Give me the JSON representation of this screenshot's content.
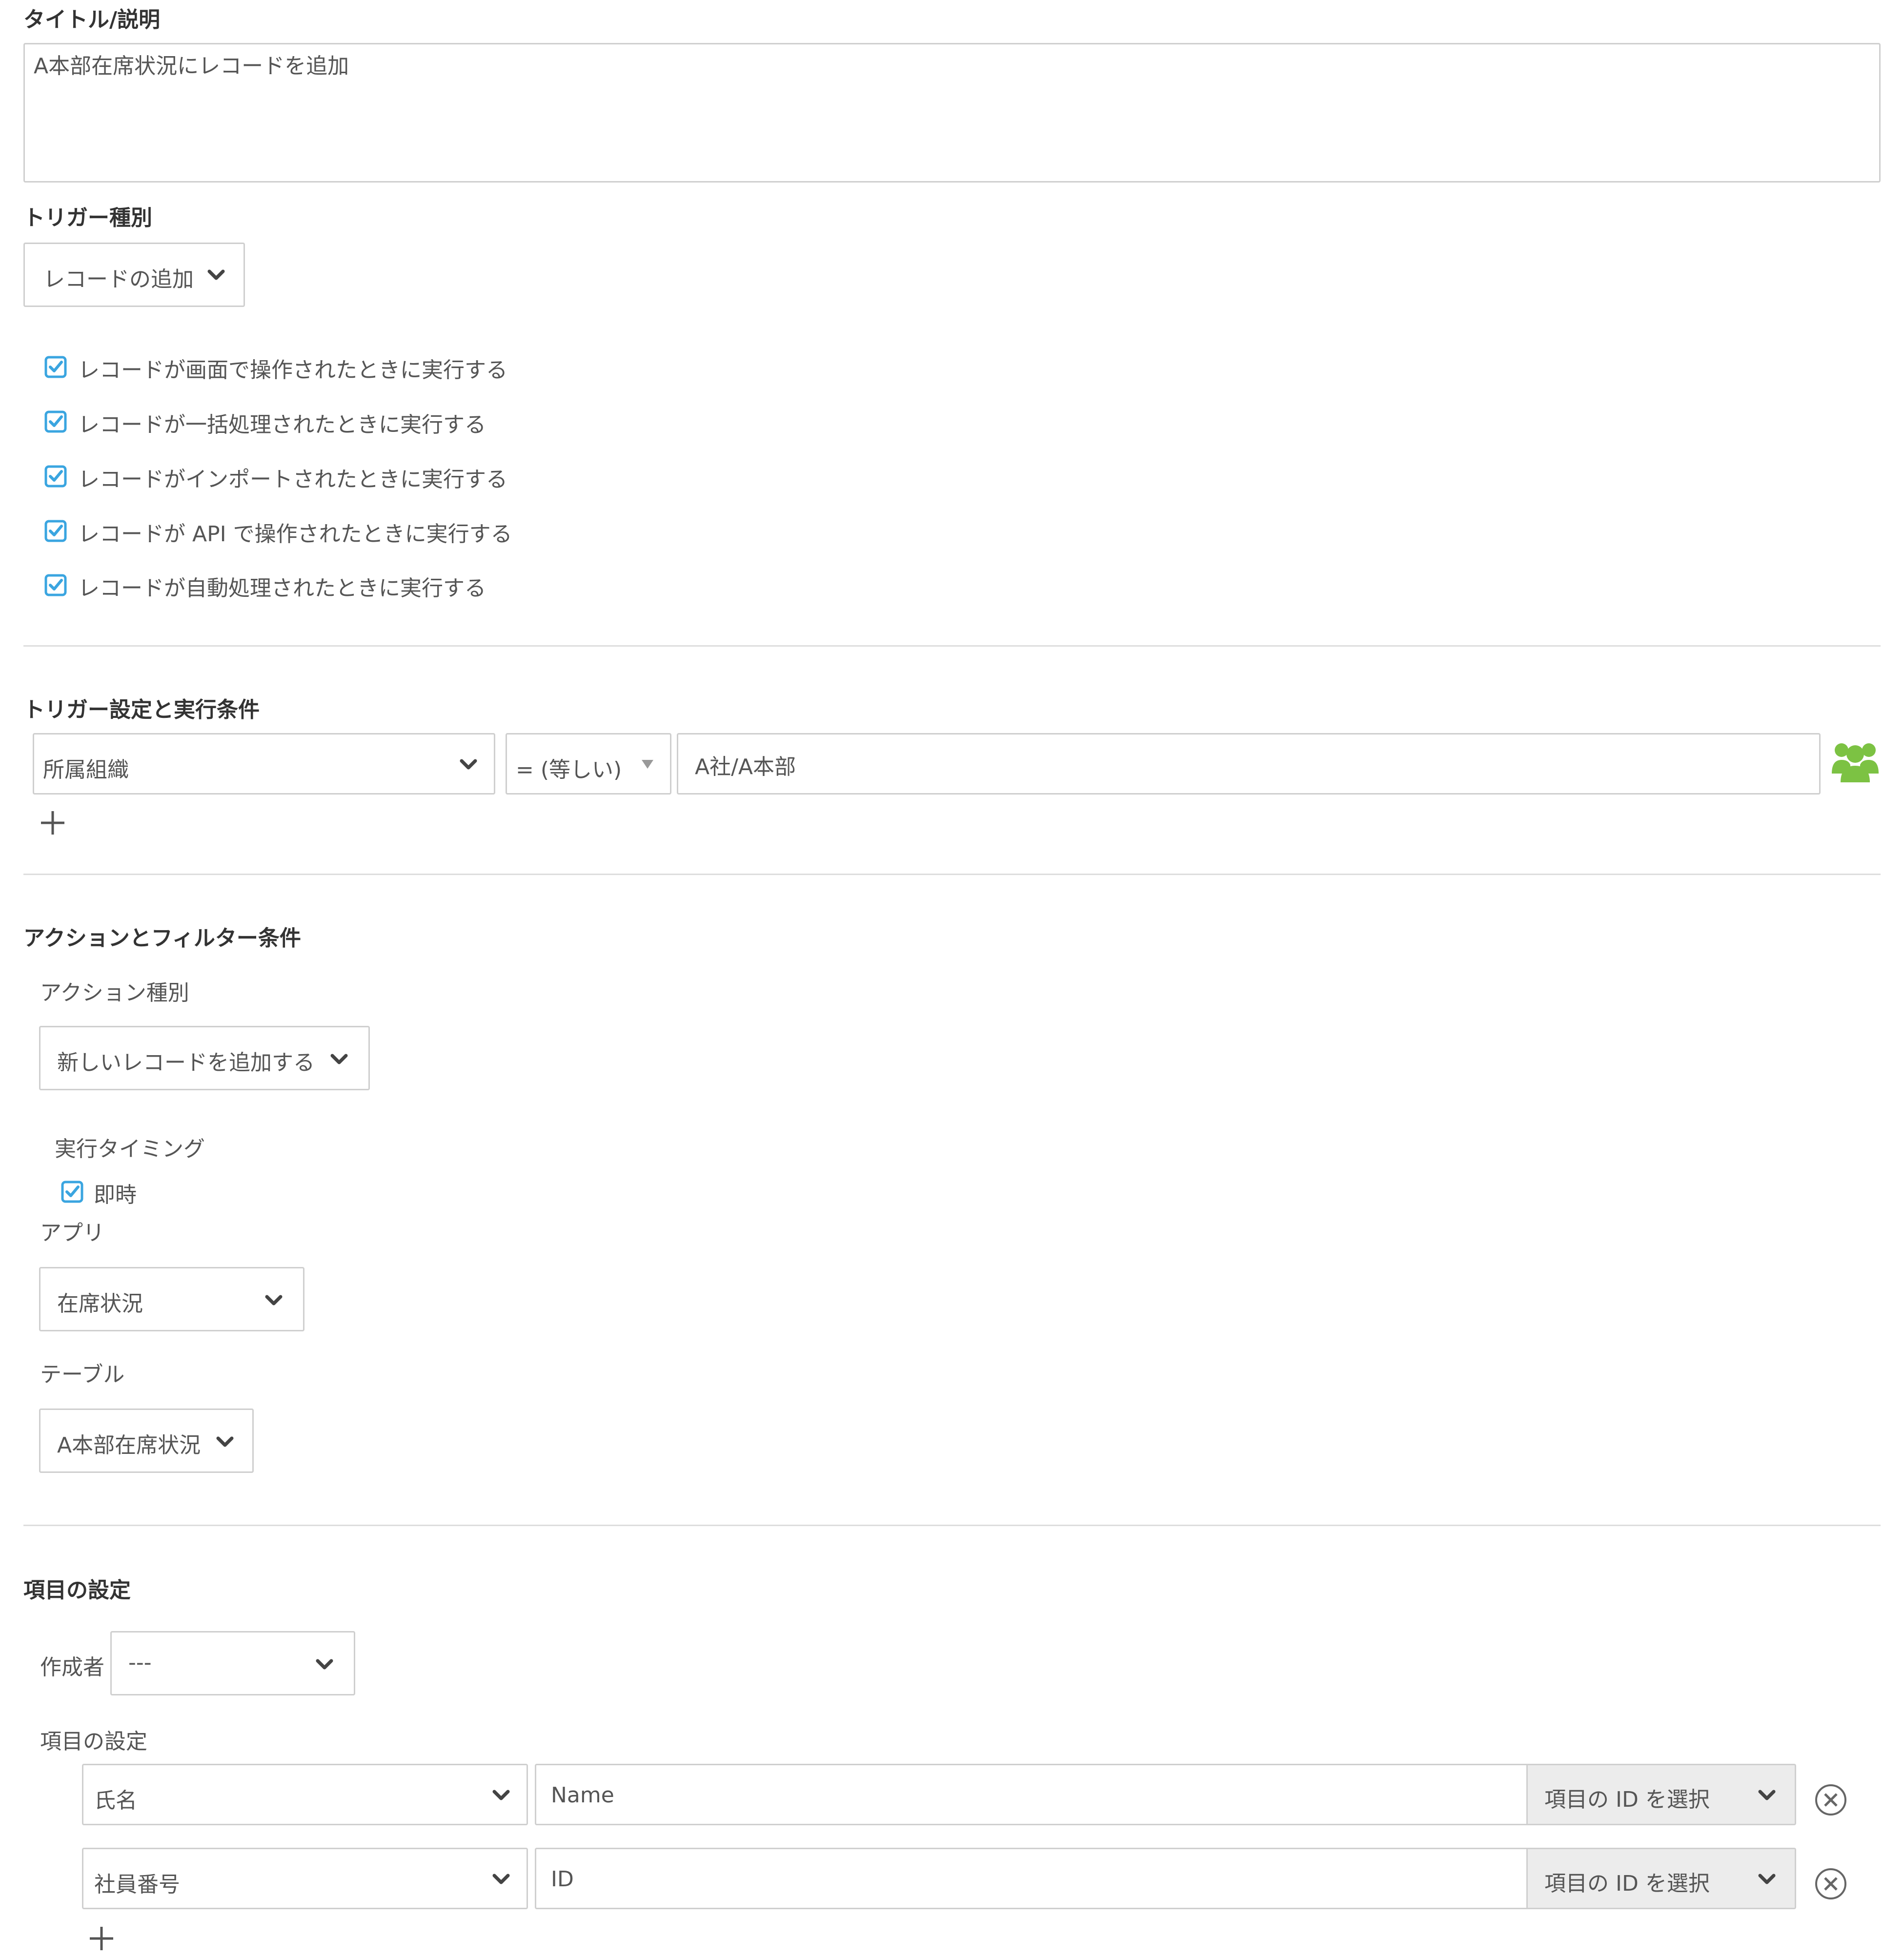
{
  "title_section": {
    "label": "タイトル/説明",
    "value": "A本部在席状況にレコードを追加"
  },
  "trigger_type": {
    "label": "トリガー種別",
    "selected": "レコードの追加",
    "options": [
      {
        "label": "レコードが画面で操作されたときに実行する",
        "checked": true
      },
      {
        "label": "レコードが一括処理されたときに実行する",
        "checked": true
      },
      {
        "label": "レコードがインポートされたときに実行する",
        "checked": true
      },
      {
        "label": "レコードが API で操作されたときに実行する",
        "checked": true
      },
      {
        "label": "レコードが自動処理されたときに実行する",
        "checked": true
      }
    ]
  },
  "trigger_conditions": {
    "label": "トリガー設定と実行条件",
    "field": "所属組織",
    "operator": "= (等しい)",
    "value": "A社/A本部",
    "group_icon": "users-group-icon",
    "group_icon_color": "#7cc243"
  },
  "action_section": {
    "label": "アクションとフィルター条件",
    "action_type_label": "アクション種別",
    "action_type_value": "新しいレコードを追加する",
    "timing_label": "実行タイミング",
    "timing_option": "即時",
    "timing_checked": true,
    "app_label": "アプリ",
    "app_value": "在席状況",
    "table_label": "テーブル",
    "table_value": "A本部在席状況"
  },
  "field_settings": {
    "label": "項目の設定",
    "creator_label": "作成者",
    "creator_value": "---",
    "sub_label": "項目の設定",
    "rows": [
      {
        "field": "氏名",
        "value": "Name",
        "id_select": "項目の ID を選択"
      },
      {
        "field": "社員番号",
        "value": "ID",
        "id_select": "項目の ID を選択"
      }
    ]
  },
  "colors": {
    "checkbox_accent": "#3aa5e0",
    "border": "#cfcfcf",
    "divider": "#dddddd"
  }
}
